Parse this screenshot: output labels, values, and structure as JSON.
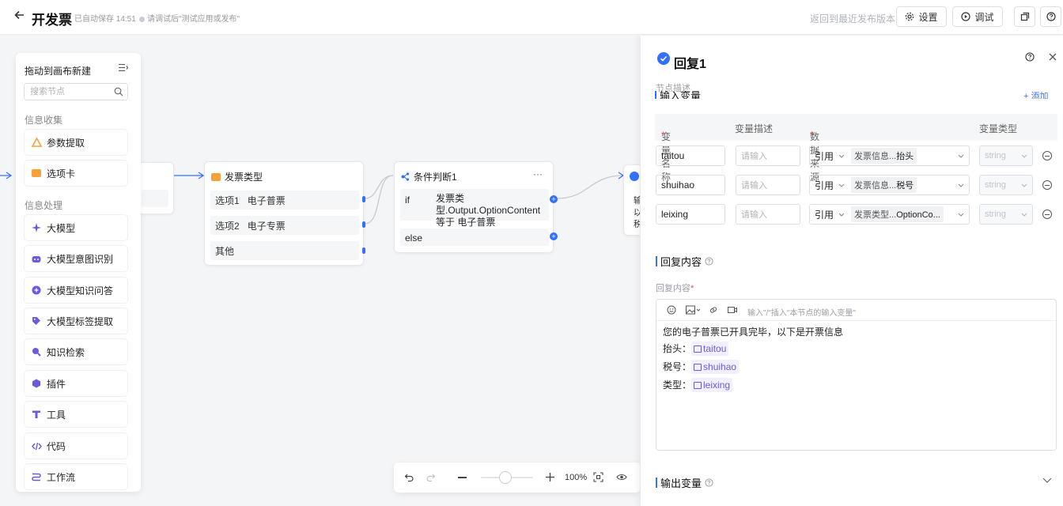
{
  "header": {
    "title": "开发票",
    "autosave": "已自动保存 14:51",
    "hint": "请调试后\"测试应用或发布\"",
    "back_version": "返回到最近发布版本",
    "settings": "设置",
    "debug": "调试"
  },
  "palette": {
    "heading": "拖动到画布新建",
    "search_placeholder": "搜索节点",
    "sections": [
      "信息收集",
      "信息处理"
    ],
    "items": [
      {
        "label": "参数提取",
        "icon": "param-extract-icon",
        "color": "#f7a13b"
      },
      {
        "label": "选项卡",
        "icon": "option-card-icon",
        "color": "#f7a13b"
      },
      {
        "label": "大模型",
        "icon": "llm-sparkle-icon",
        "color": "#6b5ae0"
      },
      {
        "label": "大模型意图识别",
        "icon": "intent-bot-icon",
        "color": "#6b5ae0"
      },
      {
        "label": "大模型知识问答",
        "icon": "knowledge-qa-icon",
        "color": "#6b5ae0"
      },
      {
        "label": "大模型标签提取",
        "icon": "tag-extract-icon",
        "color": "#6b5ae0"
      },
      {
        "label": "知识检索",
        "icon": "search-knowledge-icon",
        "color": "#6b5ae0"
      },
      {
        "label": "插件",
        "icon": "plugin-icon",
        "color": "#6b5ae0"
      },
      {
        "label": "工具",
        "icon": "tool-icon",
        "color": "#6b5ae0"
      },
      {
        "label": "代码",
        "icon": "code-icon",
        "color": "#6b5ae0"
      },
      {
        "label": "工作流",
        "icon": "workflow-icon",
        "color": "#6b5ae0"
      }
    ]
  },
  "nodes": {
    "invoice_type": {
      "title": "发票类型",
      "options": [
        "选项1",
        "选项2",
        "其他"
      ],
      "option_values": [
        "电子普票",
        "电子专票",
        ""
      ]
    },
    "condition": {
      "title": "条件判断1",
      "more": "···",
      "if_label": "if",
      "if_text": "发票类型.Output.OptionContent 等于 电子普票",
      "else_label": "else"
    },
    "reply_preview": [
      "输",
      "以",
      "税"
    ]
  },
  "zoom_toolbar": {
    "zoom": "100%"
  },
  "side_panel": {
    "title": "回复1",
    "desc_label": "节点描述",
    "input_section_partial": "输入变量",
    "add_partial": "+ 添加",
    "columns": [
      "变量名称",
      "变量描述",
      "数据来源",
      "变量类型"
    ],
    "required_mark": "*",
    "rows": [
      {
        "name": "taitou",
        "desc_placeholder": "请输入",
        "source": "引用",
        "ref_prefix": "发票信息...",
        "ref_field": "抬头",
        "type": "string"
      },
      {
        "name": "shuihao",
        "desc_placeholder": "请输入",
        "source": "引用",
        "ref_prefix": "发票信息...",
        "ref_field": "税号",
        "type": "string"
      },
      {
        "name": "leixing",
        "desc_placeholder": "请输入",
        "source": "引用",
        "ref_prefix": "发票类型...",
        "ref_field": "OptionCo...",
        "type": "string"
      }
    ],
    "reply_section": "回复内容",
    "reply_label": "回复内容",
    "editor_hint": "输入\"/\"插入\"本节点的输入变量\"",
    "reply_lines": [
      {
        "text": "您的电子普票已开具完毕，以下是开票信息",
        "var": ""
      },
      {
        "text": "抬头：",
        "var": "taitou"
      },
      {
        "text": "税号：",
        "var": "shuihao"
      },
      {
        "text": "类型：",
        "var": "leixing"
      }
    ],
    "output_section": "输出变量"
  },
  "colors": {
    "accent": "#3370ff",
    "variable": "#6b5ae0",
    "orange": "#f7a13b"
  }
}
